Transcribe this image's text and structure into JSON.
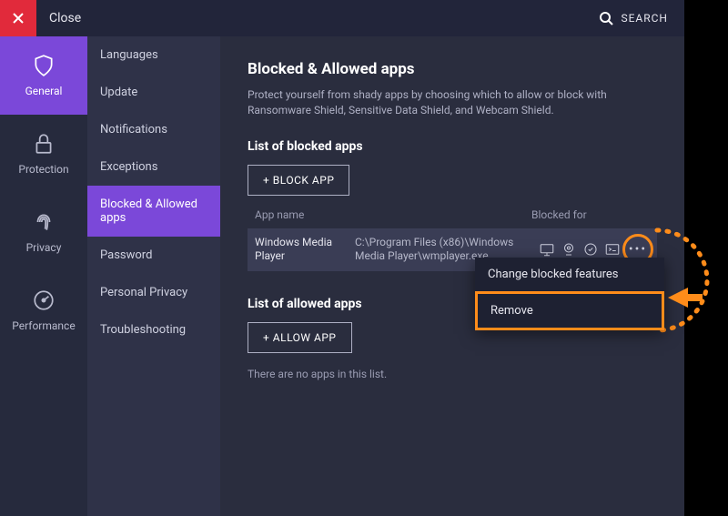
{
  "titlebar": {
    "close": "Close",
    "search": "SEARCH"
  },
  "nav1": [
    {
      "key": "general",
      "label": "General"
    },
    {
      "key": "protection",
      "label": "Protection"
    },
    {
      "key": "privacy",
      "label": "Privacy"
    },
    {
      "key": "performance",
      "label": "Performance"
    }
  ],
  "nav2": {
    "items": [
      "Languages",
      "Update",
      "Notifications",
      "Exceptions",
      "Blocked & Allowed apps",
      "Password",
      "Personal Privacy",
      "Troubleshooting"
    ],
    "active_index": 4
  },
  "page": {
    "title": "Blocked & Allowed apps",
    "desc": "Protect yourself from shady apps by choosing which to allow or block with Ransomware Shield, Sensitive Data Shield, and Webcam Shield.",
    "blocked_heading": "List of blocked apps",
    "block_btn": "+ BLOCK APP",
    "columns": {
      "name": "App name",
      "blocked_for": "Blocked for"
    },
    "blocked_apps": [
      {
        "name": "Windows Media Player",
        "path": "C:\\Program Files (x86)\\Windows Media Player\\wmplayer.exe"
      }
    ],
    "allowed_heading": "List of allowed apps",
    "allow_btn": "+ ALLOW APP",
    "empty_allowed": "There are no apps in this list."
  },
  "context_menu": {
    "items": [
      "Change blocked features",
      "Remove"
    ],
    "highlight_index": 1
  }
}
